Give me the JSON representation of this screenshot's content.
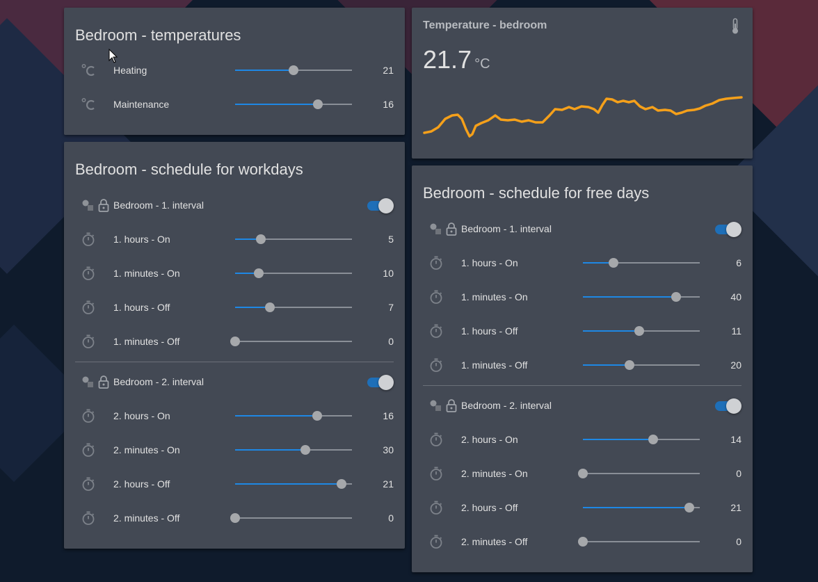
{
  "colors": {
    "background": "#0f1b2c",
    "card": "#434954",
    "accent": "#1e88e5",
    "graph_line": "#f5a01a",
    "text": "#e1e1e1"
  },
  "temperatures_card": {
    "title": "Bedroom - temperatures",
    "rows": [
      {
        "icon": "celsius-icon",
        "label": "Heating",
        "value": "21",
        "level": 0.5
      },
      {
        "icon": "celsius-icon",
        "label": "Maintenance",
        "value": "16",
        "level": 0.71
      }
    ]
  },
  "sensor_card": {
    "name": "Temperature - bedroom",
    "icon": "thermometer-icon",
    "value": "21.7",
    "unit": "°C"
  },
  "workdays_card": {
    "title": "Bedroom - schedule for workdays",
    "interval1": {
      "label": "Bedroom - 1. interval",
      "enabled": true,
      "rows": [
        {
          "label": "1. hours - On",
          "value": "5",
          "level": 0.22
        },
        {
          "label": "1. minutes - On",
          "value": "10",
          "level": 0.2
        },
        {
          "label": "1. hours - Off",
          "value": "7",
          "level": 0.3
        },
        {
          "label": "1. minutes - Off",
          "value": "0",
          "level": 0.0
        }
      ]
    },
    "interval2": {
      "label": "Bedroom - 2. interval",
      "enabled": true,
      "rows": [
        {
          "label": "2. hours - On",
          "value": "16",
          "level": 0.7
        },
        {
          "label": "2. minutes - On",
          "value": "30",
          "level": 0.6
        },
        {
          "label": "2. hours - Off",
          "value": "21",
          "level": 0.91
        },
        {
          "label": "2. minutes - Off",
          "value": "0",
          "level": 0.0
        }
      ]
    }
  },
  "freedays_card": {
    "title": "Bedroom - schedule for free days",
    "interval1": {
      "label": "Bedroom - 1. interval",
      "enabled": true,
      "rows": [
        {
          "label": "1. hours - On",
          "value": "6",
          "level": 0.26
        },
        {
          "label": "1. minutes - On",
          "value": "40",
          "level": 0.8
        },
        {
          "label": "1. hours - Off",
          "value": "11",
          "level": 0.48
        },
        {
          "label": "1. minutes - Off",
          "value": "20",
          "level": 0.4
        }
      ]
    },
    "interval2": {
      "label": "Bedroom - 2. interval",
      "enabled": true,
      "rows": [
        {
          "label": "2. hours - On",
          "value": "14",
          "level": 0.6
        },
        {
          "label": "2. minutes - On",
          "value": "0",
          "level": 0.0
        },
        {
          "label": "2. hours - Off",
          "value": "21",
          "level": 0.91
        },
        {
          "label": "2. minutes - Off",
          "value": "0",
          "level": 0.0
        }
      ]
    }
  }
}
